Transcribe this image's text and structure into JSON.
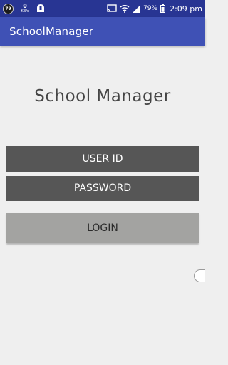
{
  "status_bar": {
    "notification_count": "79",
    "net_speed_value": "0",
    "net_speed_unit": "KB/s",
    "battery_percent": "79%",
    "time": "2:09 pm",
    "icons": [
      "notification-count-icon",
      "app-notification-icon",
      "cast-icon",
      "wifi-icon",
      "signal-icon",
      "battery-icon"
    ]
  },
  "app_bar": {
    "title": "SchoolManager"
  },
  "main": {
    "heading": "School Manager",
    "user_id_label": "USER ID",
    "password_label": "PASSWORD",
    "login_label": "LOGIN"
  },
  "colors": {
    "status_bar": "#283593",
    "app_bar": "#3f51b5",
    "background": "#efefef",
    "field": "#565656",
    "login_button": "#a3a3a1"
  }
}
